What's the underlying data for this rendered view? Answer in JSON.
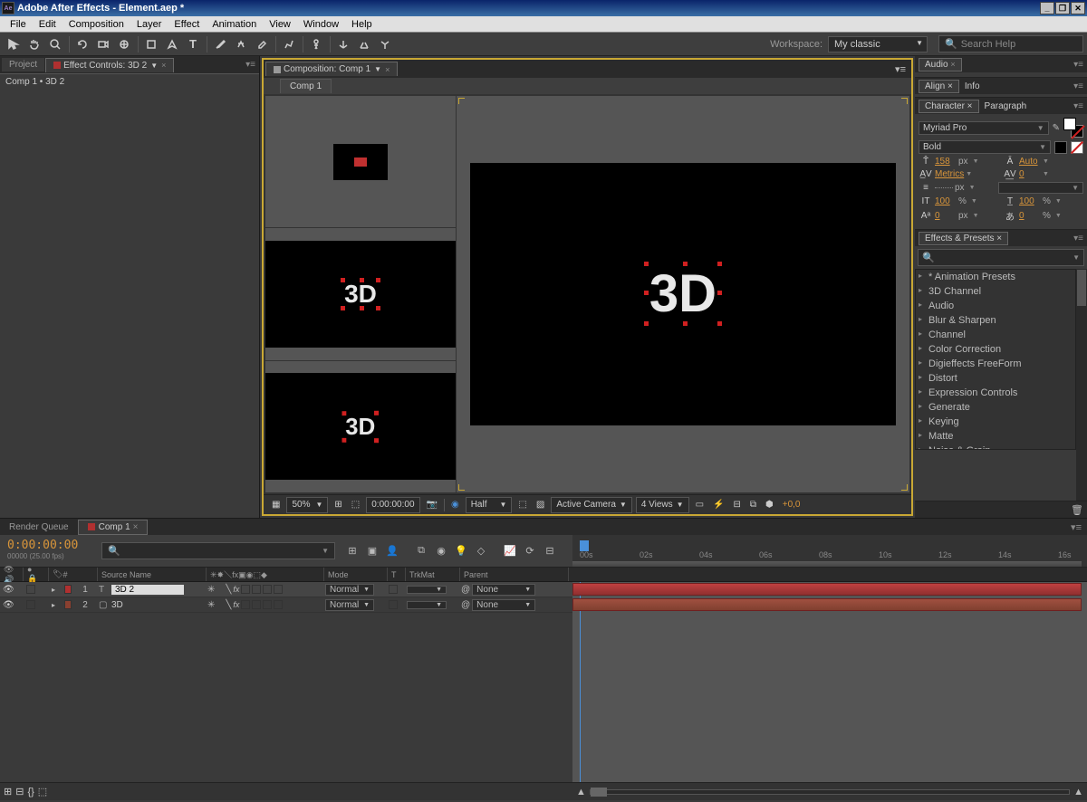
{
  "titlebar": {
    "app_icon": "Ae",
    "title": "Adobe After Effects - Element.aep *"
  },
  "menu": [
    "File",
    "Edit",
    "Composition",
    "Layer",
    "Effect",
    "Animation",
    "View",
    "Window",
    "Help"
  ],
  "toolbar": {
    "workspace_label": "Workspace:",
    "workspace_value": "My classic",
    "search_placeholder": "Search Help"
  },
  "left_panel": {
    "tabs": [
      {
        "label": "Project",
        "active": false
      },
      {
        "label": "Effect Controls: 3D 2",
        "active": true,
        "has_icon": true
      }
    ],
    "breadcrumb": "Comp 1 • 3D 2"
  },
  "comp_panel": {
    "tab": "Composition: Comp 1",
    "sub_tab": "Comp 1",
    "main_text": "3D",
    "footer": {
      "zoom": "50%",
      "time": "0:00:00:00",
      "resolution": "Half",
      "view": "Active Camera",
      "layout": "4 Views",
      "offset": "+0,0"
    }
  },
  "audio_panel": {
    "title": "Audio"
  },
  "align_panel": {
    "tabs": [
      "Align",
      "Info"
    ]
  },
  "char_panel": {
    "tabs": [
      "Character",
      "Paragraph"
    ],
    "font": "Myriad Pro",
    "style": "Bold",
    "size": "158",
    "size_unit": "px",
    "leading": "Auto",
    "kerning": "Metrics",
    "tracking": "0",
    "stroke_unit": "px",
    "vscale": "100",
    "vscale_unit": "%",
    "hscale": "100",
    "hscale_unit": "%",
    "baseline": "0",
    "baseline_unit": "px",
    "tsume": "0",
    "tsume_unit": "%"
  },
  "fx_panel": {
    "title": "Effects & Presets",
    "items": [
      "* Animation Presets",
      "3D Channel",
      "Audio",
      "Blur & Sharpen",
      "Channel",
      "Color Correction",
      "Digieffects FreeForm",
      "Distort",
      "Expression Controls",
      "Generate",
      "Keying",
      "Matte",
      "Noise & Grain"
    ]
  },
  "timeline": {
    "tabs": [
      {
        "label": "Render Queue"
      },
      {
        "label": "Comp 1",
        "active": true,
        "has_icon": true
      }
    ],
    "timecode": "0:00:00:00",
    "fps": "00000 (25.00 fps)",
    "ticks": [
      "00s",
      "02s",
      "04s",
      "06s",
      "08s",
      "10s",
      "12s",
      "14s",
      "16s"
    ],
    "cols": {
      "num": "#",
      "source": "Source Name",
      "mode": "Mode",
      "t": "T",
      "trkmat": "TrkMat",
      "parent": "Parent"
    },
    "layers": [
      {
        "num": "1",
        "name": "3D 2",
        "mode": "Normal",
        "parent": "None",
        "color": "#b03030",
        "type": "T",
        "selected": true
      },
      {
        "num": "2",
        "name": "3D",
        "mode": "Normal",
        "parent": "None",
        "color": "#8a4030",
        "type": "",
        "selected": false
      }
    ]
  }
}
